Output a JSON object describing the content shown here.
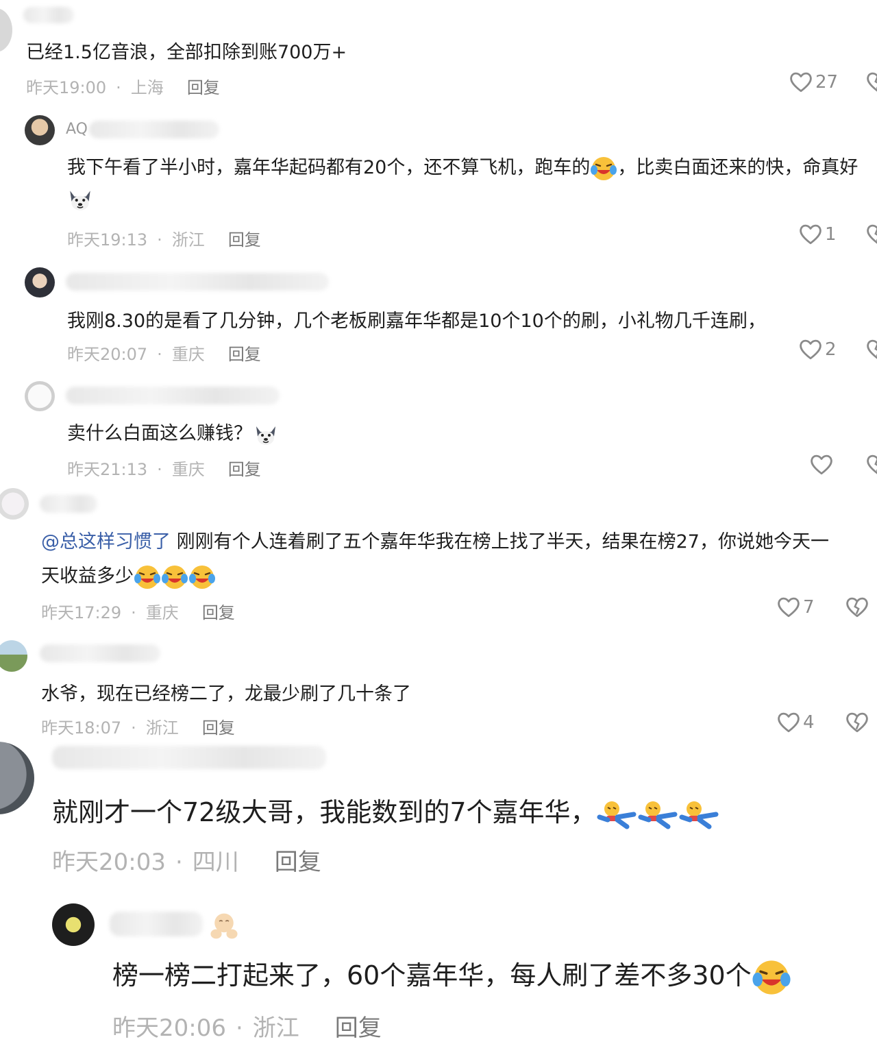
{
  "comments": [
    {
      "text": "已经1.5亿音浪，全部扣除到账700万+",
      "time": "昨天19:00",
      "location": "上海",
      "reply_label": "回复",
      "likes": "27"
    },
    {
      "name_prefix": "AQ",
      "text": "我下午看了半小时，嘉年华起码都有20个，还不算飞机，跑车的",
      "text_after_emoji": "，比卖白面还来的快，命真好",
      "time": "昨天19:13",
      "location": "浙江",
      "reply_label": "回复",
      "likes": "1"
    },
    {
      "text": "我刚8.30的是看了几分钟，几个老板刷嘉年华都是10个10个的刷，小礼物几千连刷，",
      "time": "昨天20:07",
      "location": "重庆",
      "reply_label": "回复",
      "likes": "2"
    },
    {
      "text": "卖什么白面这么赚钱？",
      "time": "昨天21:13",
      "location": "重庆",
      "reply_label": "回复",
      "likes": ""
    },
    {
      "mention": "@总这样习惯了",
      "text": "刚刚有个人连着刷了五个嘉年华我在榜上找了半天，结果在榜27，你说她今天一",
      "text_line2": "天收益多少",
      "time": "昨天17:29",
      "location": "重庆",
      "reply_label": "回复",
      "likes": "7"
    },
    {
      "text": "水爷，现在已经榜二了，龙最少刷了几十条了",
      "time": "昨天18:07",
      "location": "浙江",
      "reply_label": "回复",
      "likes": "4"
    },
    {
      "text": "就刚才一个72级大哥，我能数到的7个嘉年华，",
      "time": "昨天20:03",
      "location": "四川",
      "reply_label": "回复"
    },
    {
      "text": "榜一榜二打起来了，60个嘉年华，每人刷了差不多30个",
      "time": "昨天20:06",
      "location": "浙江",
      "reply_label": "回复"
    }
  ],
  "colors": {
    "text": "#1e1e1e",
    "meta": "#b3b3b3",
    "mention": "#3a5fa8",
    "icon": "#8a8a8a"
  }
}
